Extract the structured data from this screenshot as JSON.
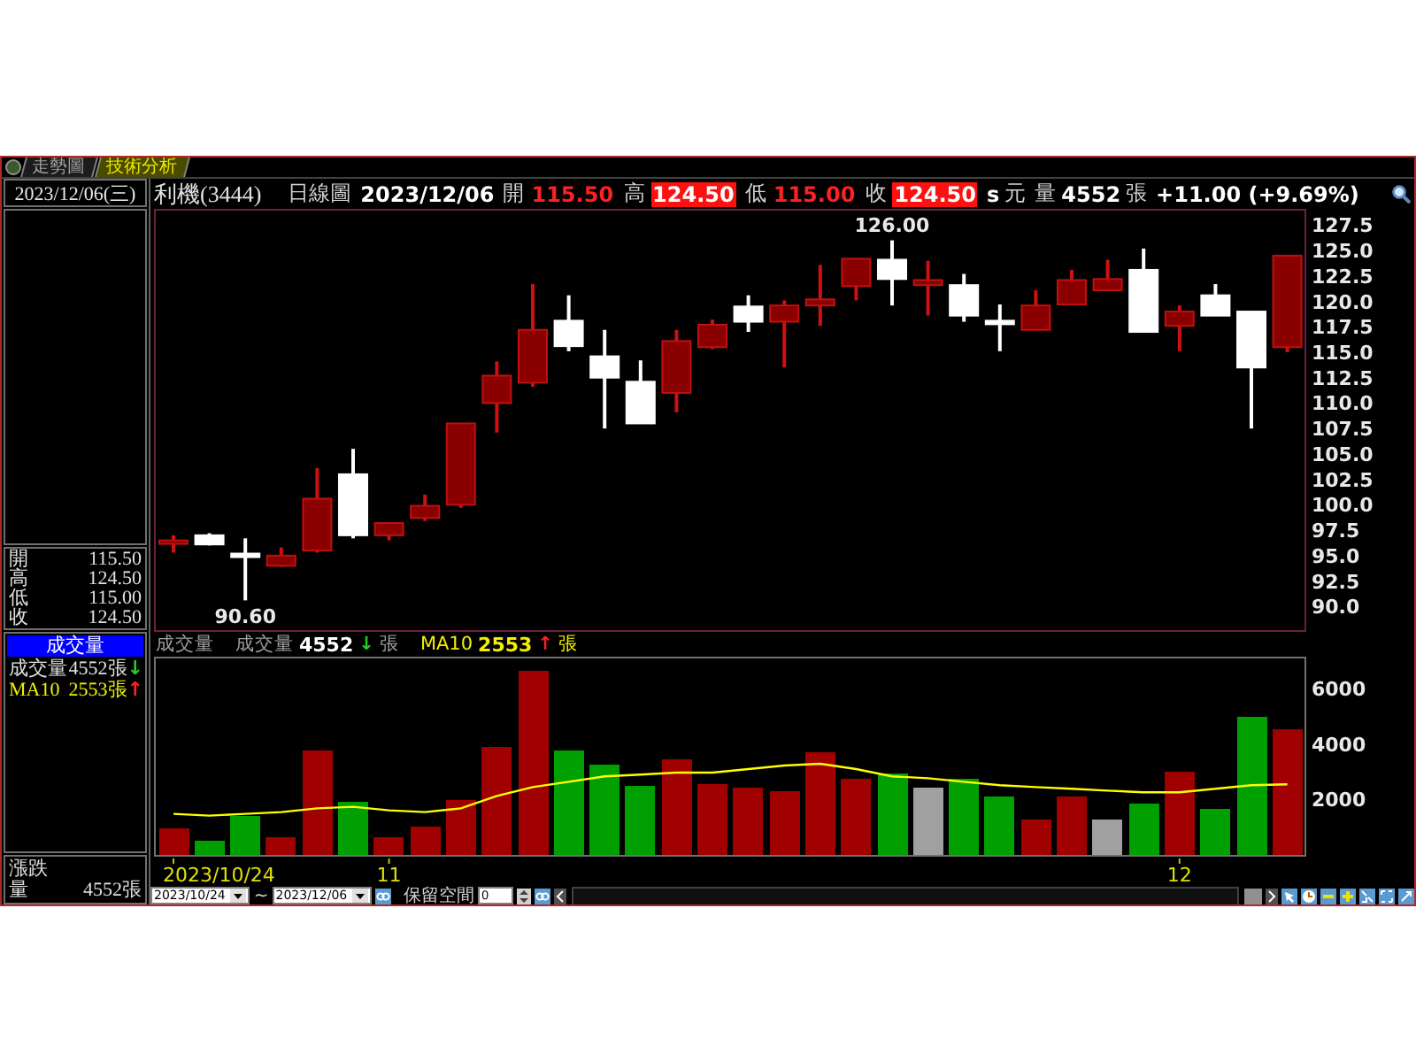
{
  "tabs": [
    {
      "label": "走勢圖",
      "selected": false
    },
    {
      "label": "技術分析",
      "selected": true
    }
  ],
  "side": {
    "date": "2023/12/06(三)",
    "quote": [
      {
        "label": "開",
        "value": "115.50"
      },
      {
        "label": "高",
        "value": "124.50"
      },
      {
        "label": "低",
        "value": "115.00"
      },
      {
        "label": "收",
        "value": "124.50"
      }
    ],
    "volume_panel": {
      "title": "成交量",
      "rows": [
        {
          "kind": "volume",
          "label": "成交量",
          "value": "4552張",
          "arrow": "↓",
          "color": "#20d020"
        },
        {
          "kind": "ma",
          "label": "MA10",
          "value": "2553張",
          "arrow": "↑",
          "color": "#ff2020"
        }
      ]
    },
    "footer": {
      "change_label": "漲跌",
      "volume_label": "量",
      "volume_value": "4552張"
    }
  },
  "header": {
    "name": "利機(3444)",
    "period": "日線圖",
    "date": "2023/12/06",
    "quotes": [
      {
        "label": "開",
        "value": "115.50",
        "highlighted": false
      },
      {
        "label": "高",
        "value": "124.50",
        "highlighted": true
      },
      {
        "label": "低",
        "value": "115.00",
        "highlighted": false
      },
      {
        "label": "收",
        "value": "124.50",
        "highlighted": true
      }
    ],
    "unit_s": "s",
    "unit": "元",
    "volume_label": "量",
    "volume": "4552",
    "volume_unit": "張",
    "change": "+11.00 (+9.69%)"
  },
  "price_chart": {
    "chart_data": {
      "type": "candlestick",
      "ylim": [
        87.5,
        129.1
      ],
      "categories": [
        null,
        null,
        null,
        null,
        null,
        null,
        null,
        null,
        null,
        null,
        null,
        null,
        null,
        null,
        null,
        null,
        null,
        null,
        null,
        null,
        null,
        null,
        null,
        null,
        null,
        null,
        null,
        null,
        null,
        null,
        null,
        null
      ],
      "yticks": [
        {
          "value": 90,
          "label": "90.0"
        },
        {
          "value": 92.5,
          "label": "92.5"
        },
        {
          "value": 95,
          "label": "95.0"
        },
        {
          "value": 97.5,
          "label": "97.5"
        },
        {
          "value": 100,
          "label": "100.0"
        },
        {
          "value": 102.5,
          "label": "102.5"
        },
        {
          "value": 105,
          "label": "105.0"
        },
        {
          "value": 107.5,
          "label": "107.5"
        },
        {
          "value": 110,
          "label": "110.0"
        },
        {
          "value": 112.5,
          "label": "112.5"
        },
        {
          "value": 115,
          "label": "115.0"
        },
        {
          "value": 117.5,
          "label": "117.5"
        },
        {
          "value": 120,
          "label": "120.0"
        },
        {
          "value": 122.5,
          "label": "122.5"
        },
        {
          "value": 125,
          "label": "125.0"
        },
        {
          "value": 127.5,
          "label": "127.5"
        }
      ],
      "ohlc": [
        [
          96.3,
          97.0,
          95.3,
          96.5
        ],
        [
          97.0,
          97.2,
          96.0,
          96.1
        ],
        [
          95.2,
          96.7,
          90.6,
          95.0
        ],
        [
          94.0,
          95.8,
          93.9,
          95.0
        ],
        [
          95.5,
          103.6,
          95.3,
          100.6
        ],
        [
          103.0,
          105.5,
          96.7,
          97.0
        ],
        [
          97.0,
          98.3,
          96.5,
          98.2
        ],
        [
          98.7,
          101.0,
          98.4,
          99.9
        ],
        [
          100.0,
          108.0,
          99.7,
          108.0
        ],
        [
          110.0,
          114.1,
          107.1,
          112.7
        ],
        [
          112.0,
          121.7,
          111.6,
          117.2
        ],
        [
          118.1,
          120.6,
          115.1,
          115.6
        ],
        [
          114.6,
          117.2,
          107.5,
          112.5
        ],
        [
          112.1,
          114.2,
          108.0,
          108.0
        ],
        [
          111.0,
          117.2,
          109.1,
          116.1
        ],
        [
          115.5,
          118.2,
          115.3,
          117.7
        ],
        [
          119.5,
          120.6,
          117.0,
          118.0
        ],
        [
          118.0,
          120.1,
          113.5,
          119.6
        ],
        [
          119.6,
          123.6,
          117.6,
          120.2
        ],
        [
          121.5,
          124.2,
          120.1,
          124.2
        ],
        [
          124.1,
          126.0,
          119.6,
          122.2
        ],
        [
          121.6,
          124.0,
          118.6,
          122.1
        ],
        [
          121.6,
          122.7,
          118.0,
          118.6
        ],
        [
          118.1,
          119.7,
          115.1,
          118.0
        ],
        [
          117.2,
          121.1,
          117.2,
          119.6
        ],
        [
          119.7,
          123.1,
          119.7,
          122.1
        ],
        [
          121.1,
          124.1,
          121.1,
          122.2
        ],
        [
          123.1,
          125.2,
          117.0,
          117.0
        ],
        [
          117.6,
          119.6,
          115.1,
          119.0
        ],
        [
          120.6,
          121.7,
          118.6,
          118.6
        ],
        [
          119.0,
          119.0,
          107.5,
          113.5
        ],
        [
          115.5,
          124.5,
          115.0,
          124.5
        ]
      ],
      "annotations": [
        {
          "text": "126.00",
          "y": 126.0
        },
        {
          "text": "90.60",
          "y": 90.6
        }
      ]
    }
  },
  "volume_header": {
    "title": "成交量",
    "items": [
      {
        "kind": "volume",
        "label": "成交量",
        "value": "4552",
        "arrow": "↓",
        "color": "#20d020",
        "unit": "張"
      },
      {
        "kind": "ma",
        "label": "MA10",
        "value": "2553",
        "arrow": "↑",
        "color": "#ff2020",
        "unit": "張"
      }
    ]
  },
  "volume_chart": {
    "chart_data": {
      "type": "bar",
      "ylim": [
        0,
        7160
      ],
      "yticks": [
        2000,
        4000,
        6000
      ],
      "categories": [
        null,
        null,
        null,
        null,
        null,
        null,
        "11",
        null,
        null,
        null,
        null,
        null,
        null,
        null,
        null,
        null,
        null,
        null,
        null,
        null,
        null,
        null,
        null,
        null,
        null,
        null,
        null,
        null,
        "12",
        null,
        null,
        null
      ],
      "series": [
        {
          "values": [
            970,
            520,
            1420,
            650,
            3800,
            1940,
            650,
            1030,
            2000,
            3870,
            6640,
            3740,
            3290,
            2520,
            3480,
            2580,
            2450,
            2320,
            3680,
            2770,
            2970,
            2450,
            2770,
            2130,
            1290,
            2130,
            1290,
            1870,
            3030,
            1680,
            4970,
            4550
          ],
          "colors": [
            "#a00000",
            "#00a000",
            "#00a000",
            "#a00000",
            "#a00000",
            "#00a000",
            "#a00000",
            "#a00000",
            "#a00000",
            "#a00000",
            "#a00000",
            "#00a000",
            "#00a000",
            "#00a000",
            "#a00000",
            "#a00000",
            "#a00000",
            "#a00000",
            "#a00000",
            "#a00000",
            "#00a000",
            "#a0a0a0",
            "#00a000",
            "#00a000",
            "#a00000",
            "#a00000",
            "#a0a0a0",
            "#00a000",
            "#a00000",
            "#00a000",
            "#00a000",
            "#a00000"
          ]
        },
        {
          "type": "line",
          "color": "#ffff00",
          "values": [
            1480,
            1420,
            1480,
            1550,
            1680,
            1740,
            1610,
            1550,
            1680,
            2130,
            2450,
            2640,
            2840,
            2900,
            2970,
            2970,
            3100,
            3230,
            3290,
            3100,
            2840,
            2770,
            2640,
            2520,
            2450,
            2390,
            2320,
            2260,
            2260,
            2390,
            2520,
            2550
          ]
        }
      ]
    },
    "start_label": "2023/10/24"
  },
  "toolbar": {
    "start_date": "2023/10/24",
    "separator": "~",
    "end_date": "2023/12/06",
    "reserve_label": "保留空間",
    "reserve_value": "0"
  }
}
